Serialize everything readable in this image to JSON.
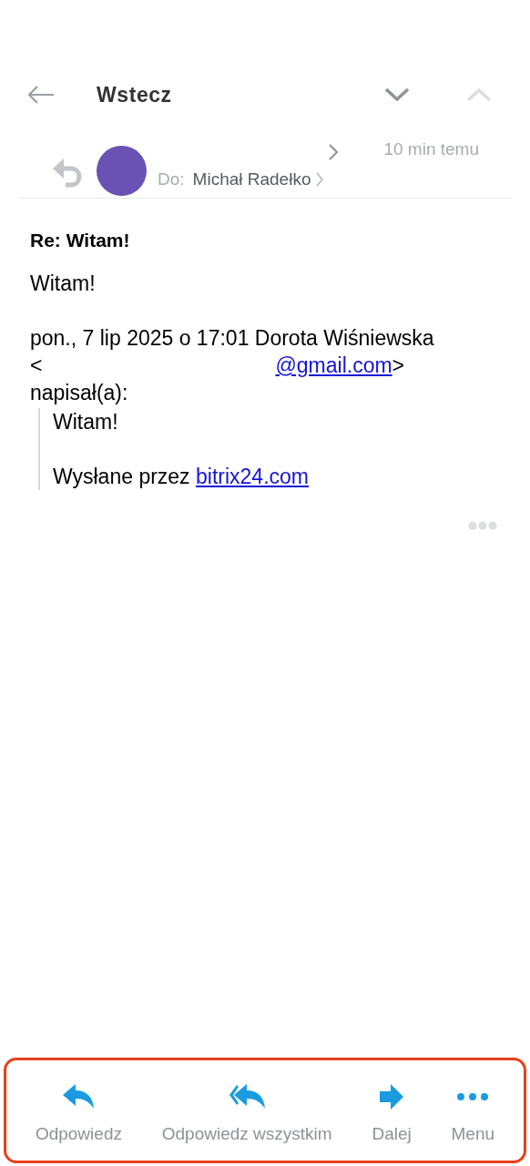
{
  "header": {
    "back_label": "Wstecz",
    "next_disabled": false,
    "prev_disabled": true
  },
  "message": {
    "time": "10 min temu",
    "to_label": "Do:",
    "recipient": "Michał Radełko",
    "subject": "Re: Witam!"
  },
  "body": {
    "greeting": "Witam!",
    "quote_header": {
      "before": "pon., 7 lip 2025 o 17:01 Dorota Wiśniewska",
      "open": "<",
      "link": "@gmail.com",
      "close": ">",
      "after": "napisał(a):"
    },
    "quote": {
      "greeting": "Witam!",
      "signature": "Wysłane przez",
      "signature_link": "bitrix24.com"
    }
  },
  "toolbar": {
    "highlighted": true,
    "actions": [
      {
        "kind": "reply",
        "label": "Odpowiedz"
      },
      {
        "kind": "reply_all",
        "label": "Odpowiedz wszystkim"
      },
      {
        "kind": "forward",
        "label": "Dalej"
      },
      {
        "kind": "menu",
        "label": "Menu"
      }
    ]
  }
}
